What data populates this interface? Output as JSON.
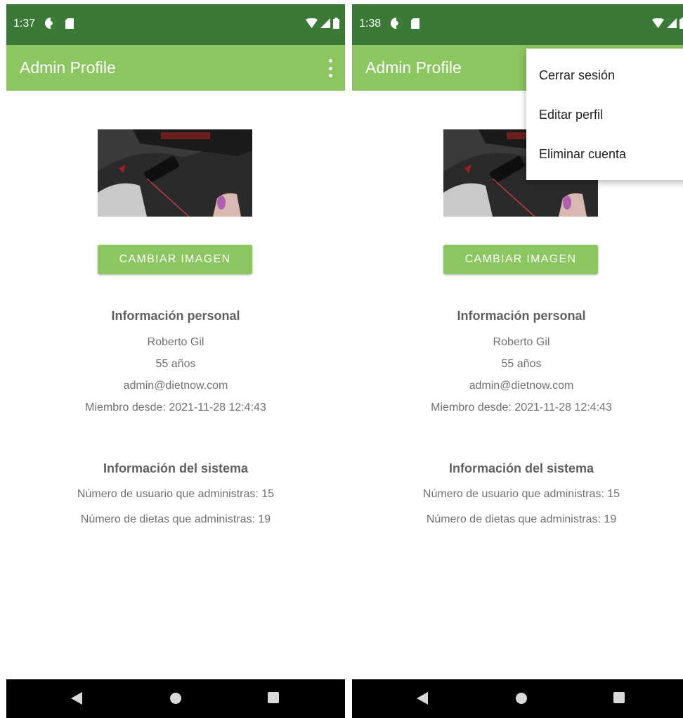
{
  "screens": [
    {
      "status": {
        "time": "1:37"
      },
      "app_bar": {
        "title": "Admin Profile"
      },
      "profile": {
        "change_image_button": "CAMBIAR IMAGEN",
        "personal_heading": "Información personal",
        "name": "Roberto Gil",
        "age": "55 años",
        "email": "admin@dietnow.com",
        "member_since": "Miembro desde: 2021-11-28 12:4:43",
        "system_heading": "Información del sistema",
        "users_count": "Número de usuario que administras: 15",
        "diets_count": "Número de dietas que administras: 19"
      }
    },
    {
      "status": {
        "time": "1:38"
      },
      "app_bar": {
        "title": "Admin Profile"
      },
      "profile": {
        "change_image_button": "CAMBIAR IMAGEN",
        "personal_heading": "Información personal",
        "name": "Roberto Gil",
        "age": "55 años",
        "email": "admin@dietnow.com",
        "member_since": "Miembro desde: 2021-11-28 12:4:43",
        "system_heading": "Información del sistema",
        "users_count": "Número de usuario que administras: 15",
        "diets_count": "Número de dietas que administras: 19"
      },
      "menu": {
        "items": [
          "Cerrar sesión",
          "Editar perfil",
          "Eliminar cuenta"
        ]
      }
    }
  ],
  "colors": {
    "status_bar": "#3a7a36",
    "app_bar": "#8bc660",
    "button": "#8bc660",
    "text_secondary": "#707070"
  },
  "icons": [
    "shield-icon",
    "sd-card-icon",
    "wifi-icon",
    "signal-icon",
    "battery-icon",
    "overflow-menu-icon",
    "back-icon",
    "home-icon",
    "recents-icon"
  ]
}
